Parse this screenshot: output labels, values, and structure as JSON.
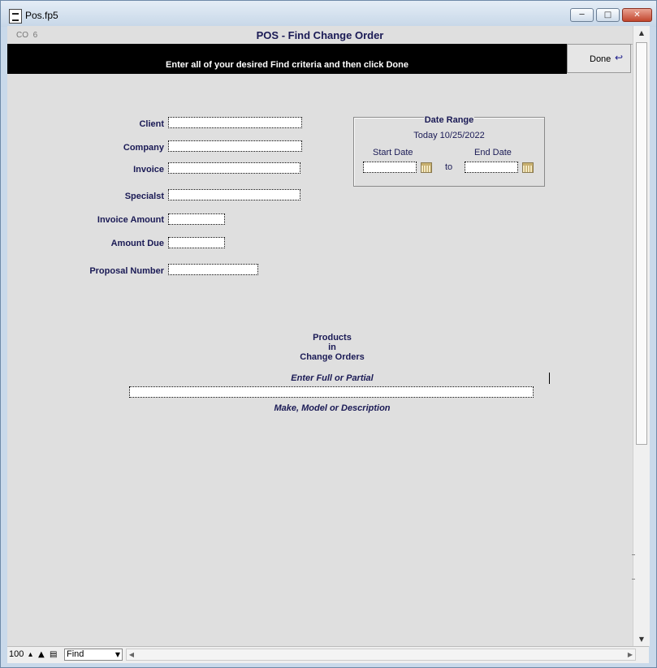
{
  "window": {
    "title": "Pos.fp5"
  },
  "header": {
    "layout_code": "CO",
    "layout_number": "6",
    "title": "POS - Find Change Order",
    "instructions": "Enter all of your desired Find criteria and then click Done",
    "done_label": "Done"
  },
  "form": {
    "client_label": "Client",
    "company_label": "Company",
    "invoice_label": "Invoice",
    "specialist_label": "Specialst",
    "invoice_amount_label": "Invoice Amount",
    "amount_due_label": "Amount Due",
    "proposal_number_label": "Proposal Number"
  },
  "date_range": {
    "title": "Date Range",
    "today": "Today 10/25/2022",
    "start_label": "Start Date",
    "to_label": "to",
    "end_label": "End Date"
  },
  "products": {
    "line1": "Products",
    "line2": "in",
    "line3": "Change Orders",
    "hint_top": "Enter Full or Partial",
    "hint_bottom": "Make, Model or Description"
  },
  "status_bar": {
    "zoom": "100",
    "mode": "Find"
  },
  "icons": {
    "app": "document-icon",
    "done": "return-arrow-icon",
    "calendar": "calendar-icon"
  }
}
